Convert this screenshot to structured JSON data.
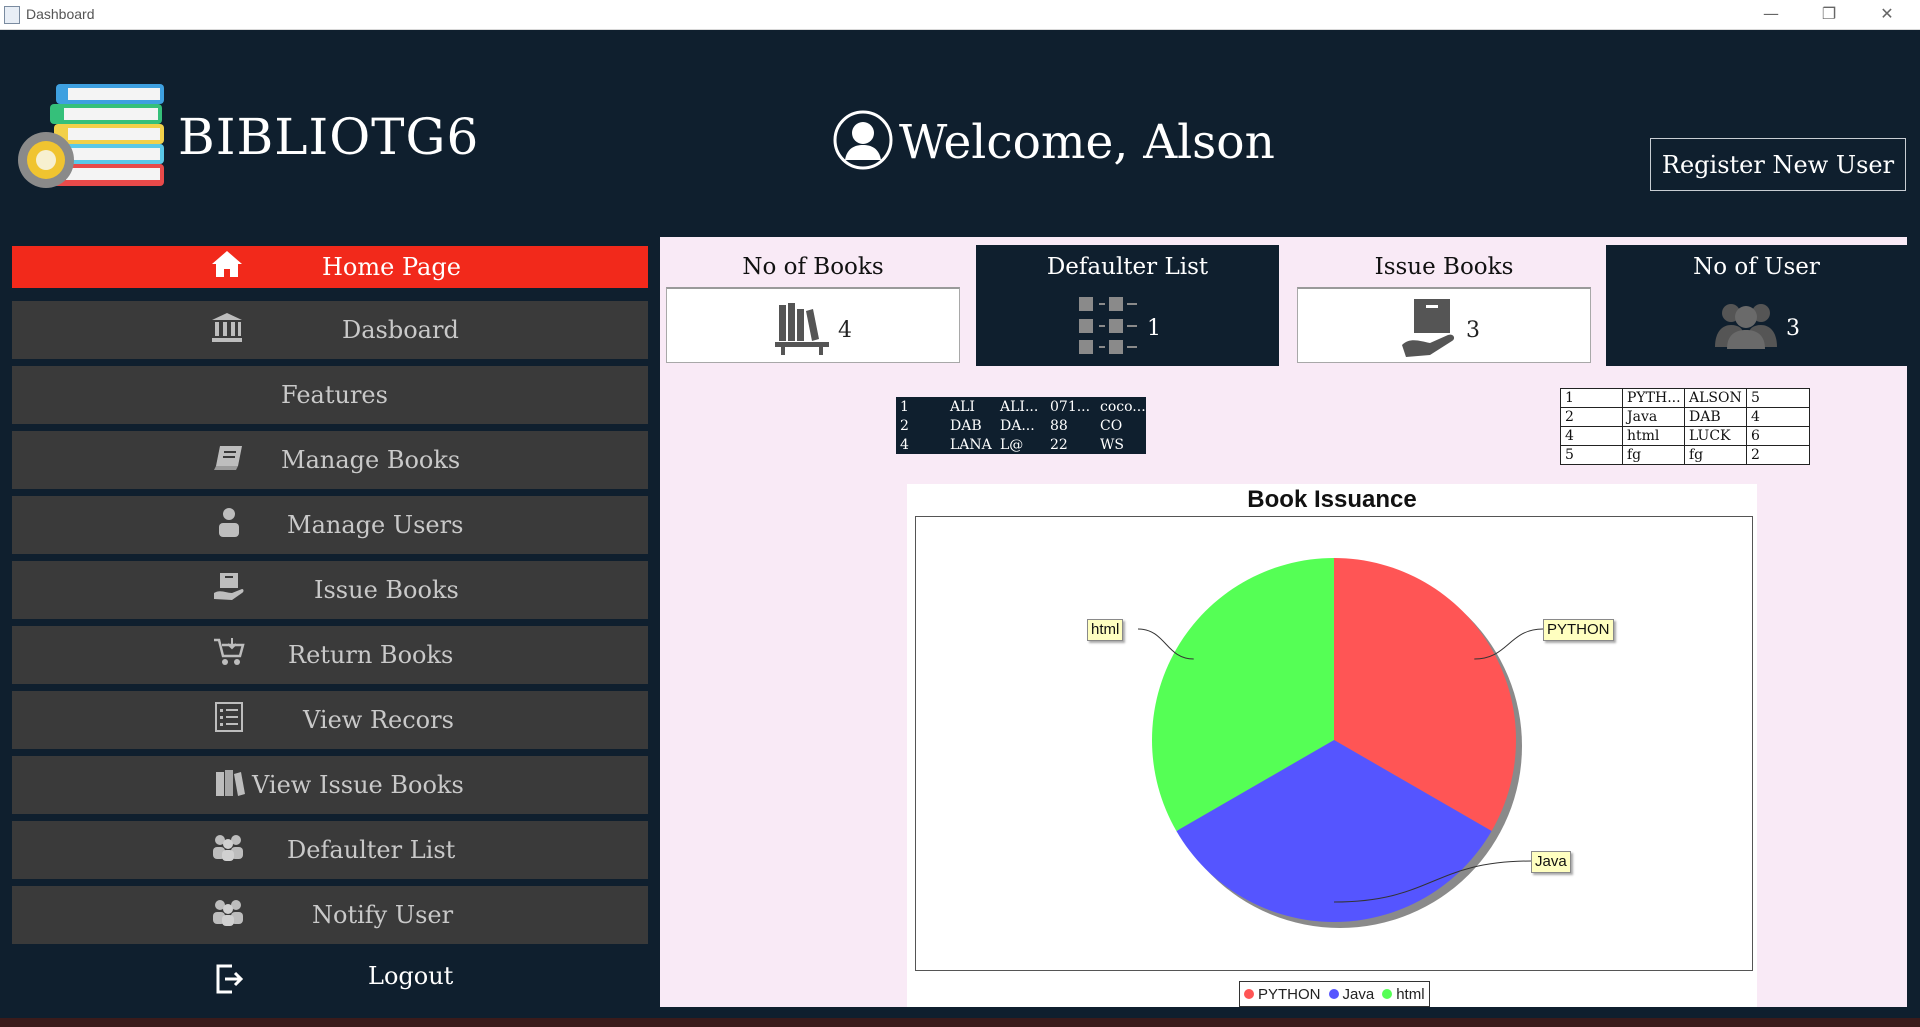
{
  "window": {
    "title": "Dashboard"
  },
  "header": {
    "app_name": "BIBLIOTG6",
    "welcome": "Welcome, Alson",
    "register_button": "Register New User"
  },
  "sidebar": {
    "items": [
      {
        "label": "Home Page",
        "icon": "home-icon"
      },
      {
        "label": "Dasboard",
        "icon": "bank-icon"
      },
      {
        "label": "Features",
        "icon": ""
      },
      {
        "label": "Manage Books",
        "icon": "book-icon"
      },
      {
        "label": "Manage Users",
        "icon": "user-icon"
      },
      {
        "label": "Issue Books",
        "icon": "hand-box-icon"
      },
      {
        "label": "Return Books",
        "icon": "cart-icon"
      },
      {
        "label": "View Recors",
        "icon": "list-icon"
      },
      {
        "label": "View Issue Books",
        "icon": "books-stack-icon"
      },
      {
        "label": "Defaulter List",
        "icon": "group-icon"
      },
      {
        "label": "Notify User",
        "icon": "group-icon"
      }
    ],
    "logout": "Logout"
  },
  "cards": [
    {
      "title": "No of Books",
      "value": "4",
      "icon": "bookshelf-icon",
      "theme": "light"
    },
    {
      "title": "Defaulter List",
      "value": "1",
      "icon": "checklist-icon",
      "theme": "dark"
    },
    {
      "title": "Issue Books",
      "value": "3",
      "icon": "hand-box-icon",
      "theme": "light"
    },
    {
      "title": "No of User",
      "value": "3",
      "icon": "users-icon",
      "theme": "dark"
    }
  ],
  "table_left": {
    "rows": [
      [
        "1",
        "ALI",
        "ALI...",
        "071...",
        "coco..."
      ],
      [
        "2",
        "DAB",
        "DA...",
        "88",
        "CO"
      ],
      [
        "4",
        "LANA",
        "L@",
        "22",
        "WS"
      ]
    ]
  },
  "table_right": {
    "rows": [
      [
        "1",
        "PYTH...",
        "ALSON",
        "5"
      ],
      [
        "2",
        "Java",
        "DAB",
        "4"
      ],
      [
        "4",
        "html",
        "LUCK",
        "6"
      ],
      [
        "5",
        "fg",
        "fg",
        "2"
      ]
    ]
  },
  "chart_data": {
    "type": "pie",
    "title": "Book Issuance",
    "categories": [
      "PYTHON",
      "Java",
      "html"
    ],
    "values": [
      1,
      1,
      1
    ],
    "colors": [
      "#ff5555",
      "#5555ff",
      "#55ff55"
    ],
    "legend": "bottom"
  },
  "colors": {
    "background": "#0f1f2e",
    "active_nav": "#f2291b",
    "nav_item": "#3a3a3a",
    "content_bg": "#f9eaf6"
  }
}
